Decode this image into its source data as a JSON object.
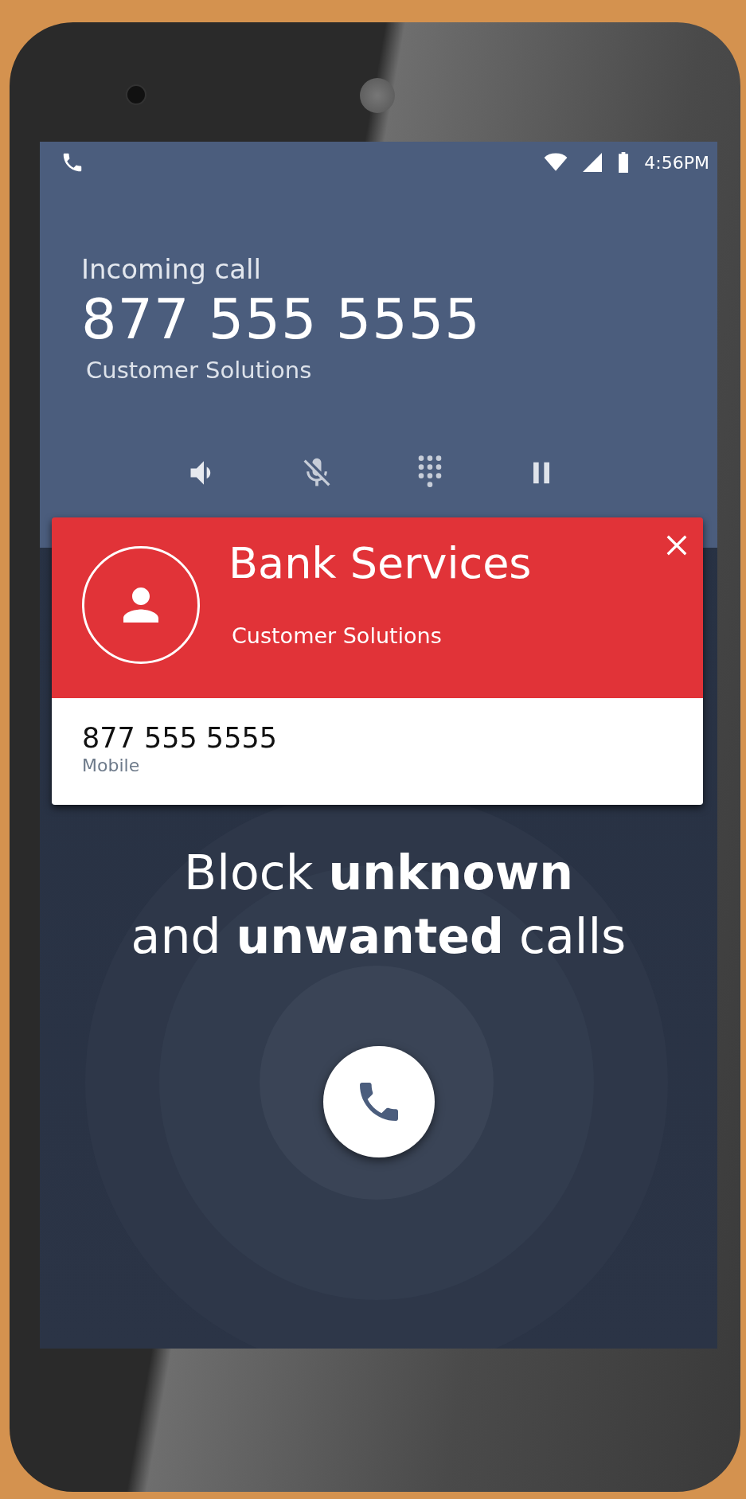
{
  "status_bar": {
    "time": "4:56PM"
  },
  "call": {
    "label": "Incoming call",
    "number": "877 555 5555",
    "caller": "Customer Solutions"
  },
  "call_controls": [
    {
      "kind": "speaker"
    },
    {
      "kind": "mute"
    },
    {
      "kind": "dialpad"
    },
    {
      "kind": "hold"
    }
  ],
  "caller_card": {
    "title": "Bank Services",
    "subtitle": "Customer Solutions",
    "number": "877 555 5555",
    "number_type": "Mobile"
  },
  "tagline": "Block **unknown**\nand **unwanted** calls"
}
